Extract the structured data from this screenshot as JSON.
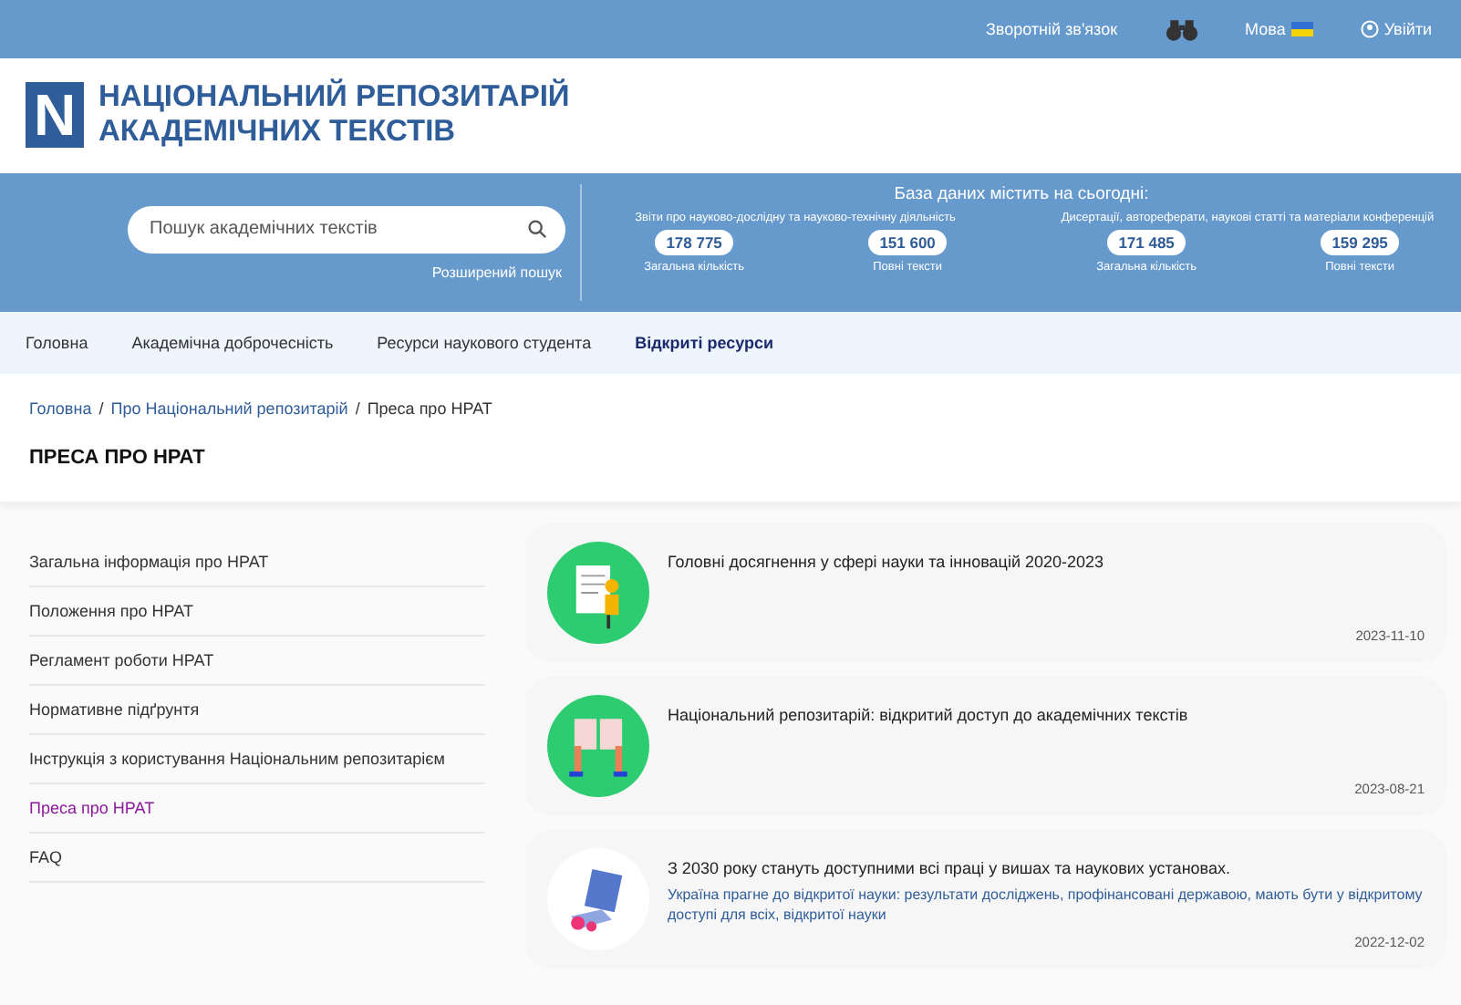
{
  "top_bar": {
    "links": [
      {
        "label": "Зворотній зв'язок",
        "kind": "text"
      },
      {
        "kind": "binoculars"
      },
      {
        "label": "Мова",
        "kind": "language"
      },
      {
        "label": "Увійти",
        "kind": "login"
      }
    ]
  },
  "header": {
    "logo_letter": "N",
    "title_line_1": "НАЦІОНАЛЬНИЙ РЕПОЗИТАРІЙ",
    "title_line_2": "АКАДЕМІЧНИХ ТЕКСТІВ"
  },
  "search": {
    "placeholder": "Пошук академічних текстів",
    "advanced_link": "Розширений пошук"
  },
  "stats": {
    "title": "База даних містить на сьогодні:",
    "groups": [
      {
        "heading": "Звіти про науково-дослідну та науково-технічну діяльність",
        "items": [
          {
            "value": "178 775",
            "caption": "Загальна кількість"
          },
          {
            "value": "151 600",
            "caption": "Повні тексти"
          }
        ]
      },
      {
        "heading": "Дисертації, автореферати, наукові статті та матеріали конференцій",
        "items": [
          {
            "value": "171 485",
            "caption": "Загальна кількість"
          },
          {
            "value": "159 295",
            "caption": "Повні тексти"
          }
        ]
      }
    ]
  },
  "nav": [
    {
      "label": "Головна",
      "selected": false
    },
    {
      "label": "Академічна доброчесність",
      "selected": false
    },
    {
      "label": "Ресурси наукового студента",
      "selected": false
    },
    {
      "label": "Відкриті ресурси",
      "selected": true
    }
  ],
  "breadcrumb": [
    {
      "label": "Головна",
      "separator": "/"
    },
    {
      "label": "Про Національний репозитарій",
      "separator": "/"
    },
    {
      "label": "Преса про НРАТ"
    }
  ],
  "page_title": "ПРЕСА ПРО НРАТ",
  "sidebar": {
    "items": [
      {
        "label": "Загальна інформація про НРАТ",
        "selected": false
      },
      {
        "label": "Положення про НРАТ",
        "selected": false
      },
      {
        "label": "Регламент роботи НРАТ",
        "selected": false
      },
      {
        "label": "Нормативне підґрунтя",
        "selected": false
      },
      {
        "label": "Інструкція з користування Національним репозитарієм",
        "selected": false
      },
      {
        "label": "Преса про НРАТ",
        "selected": true
      },
      {
        "label": "FAQ",
        "selected": false
      }
    ]
  },
  "articles": [
    {
      "title": "Головні досягнення у сфері науки та інновацій 2020-2023",
      "date": "2023-11-10",
      "kind": "document"
    },
    {
      "title": "Національний репозитарій: відкритий доступ до академічних текстів",
      "date": "2023-08-21",
      "kind": "book"
    },
    {
      "title": "З 2030 року стануть доступними всі праці у вишах та наукових установах.",
      "subtitle": "Україна прагне до відкритої науки: результати досліджень, профінансовані державою, мають бути у відкритому доступі для всіх, відкритої науки",
      "date": "2022-12-02",
      "kind": "laptop"
    }
  ]
}
